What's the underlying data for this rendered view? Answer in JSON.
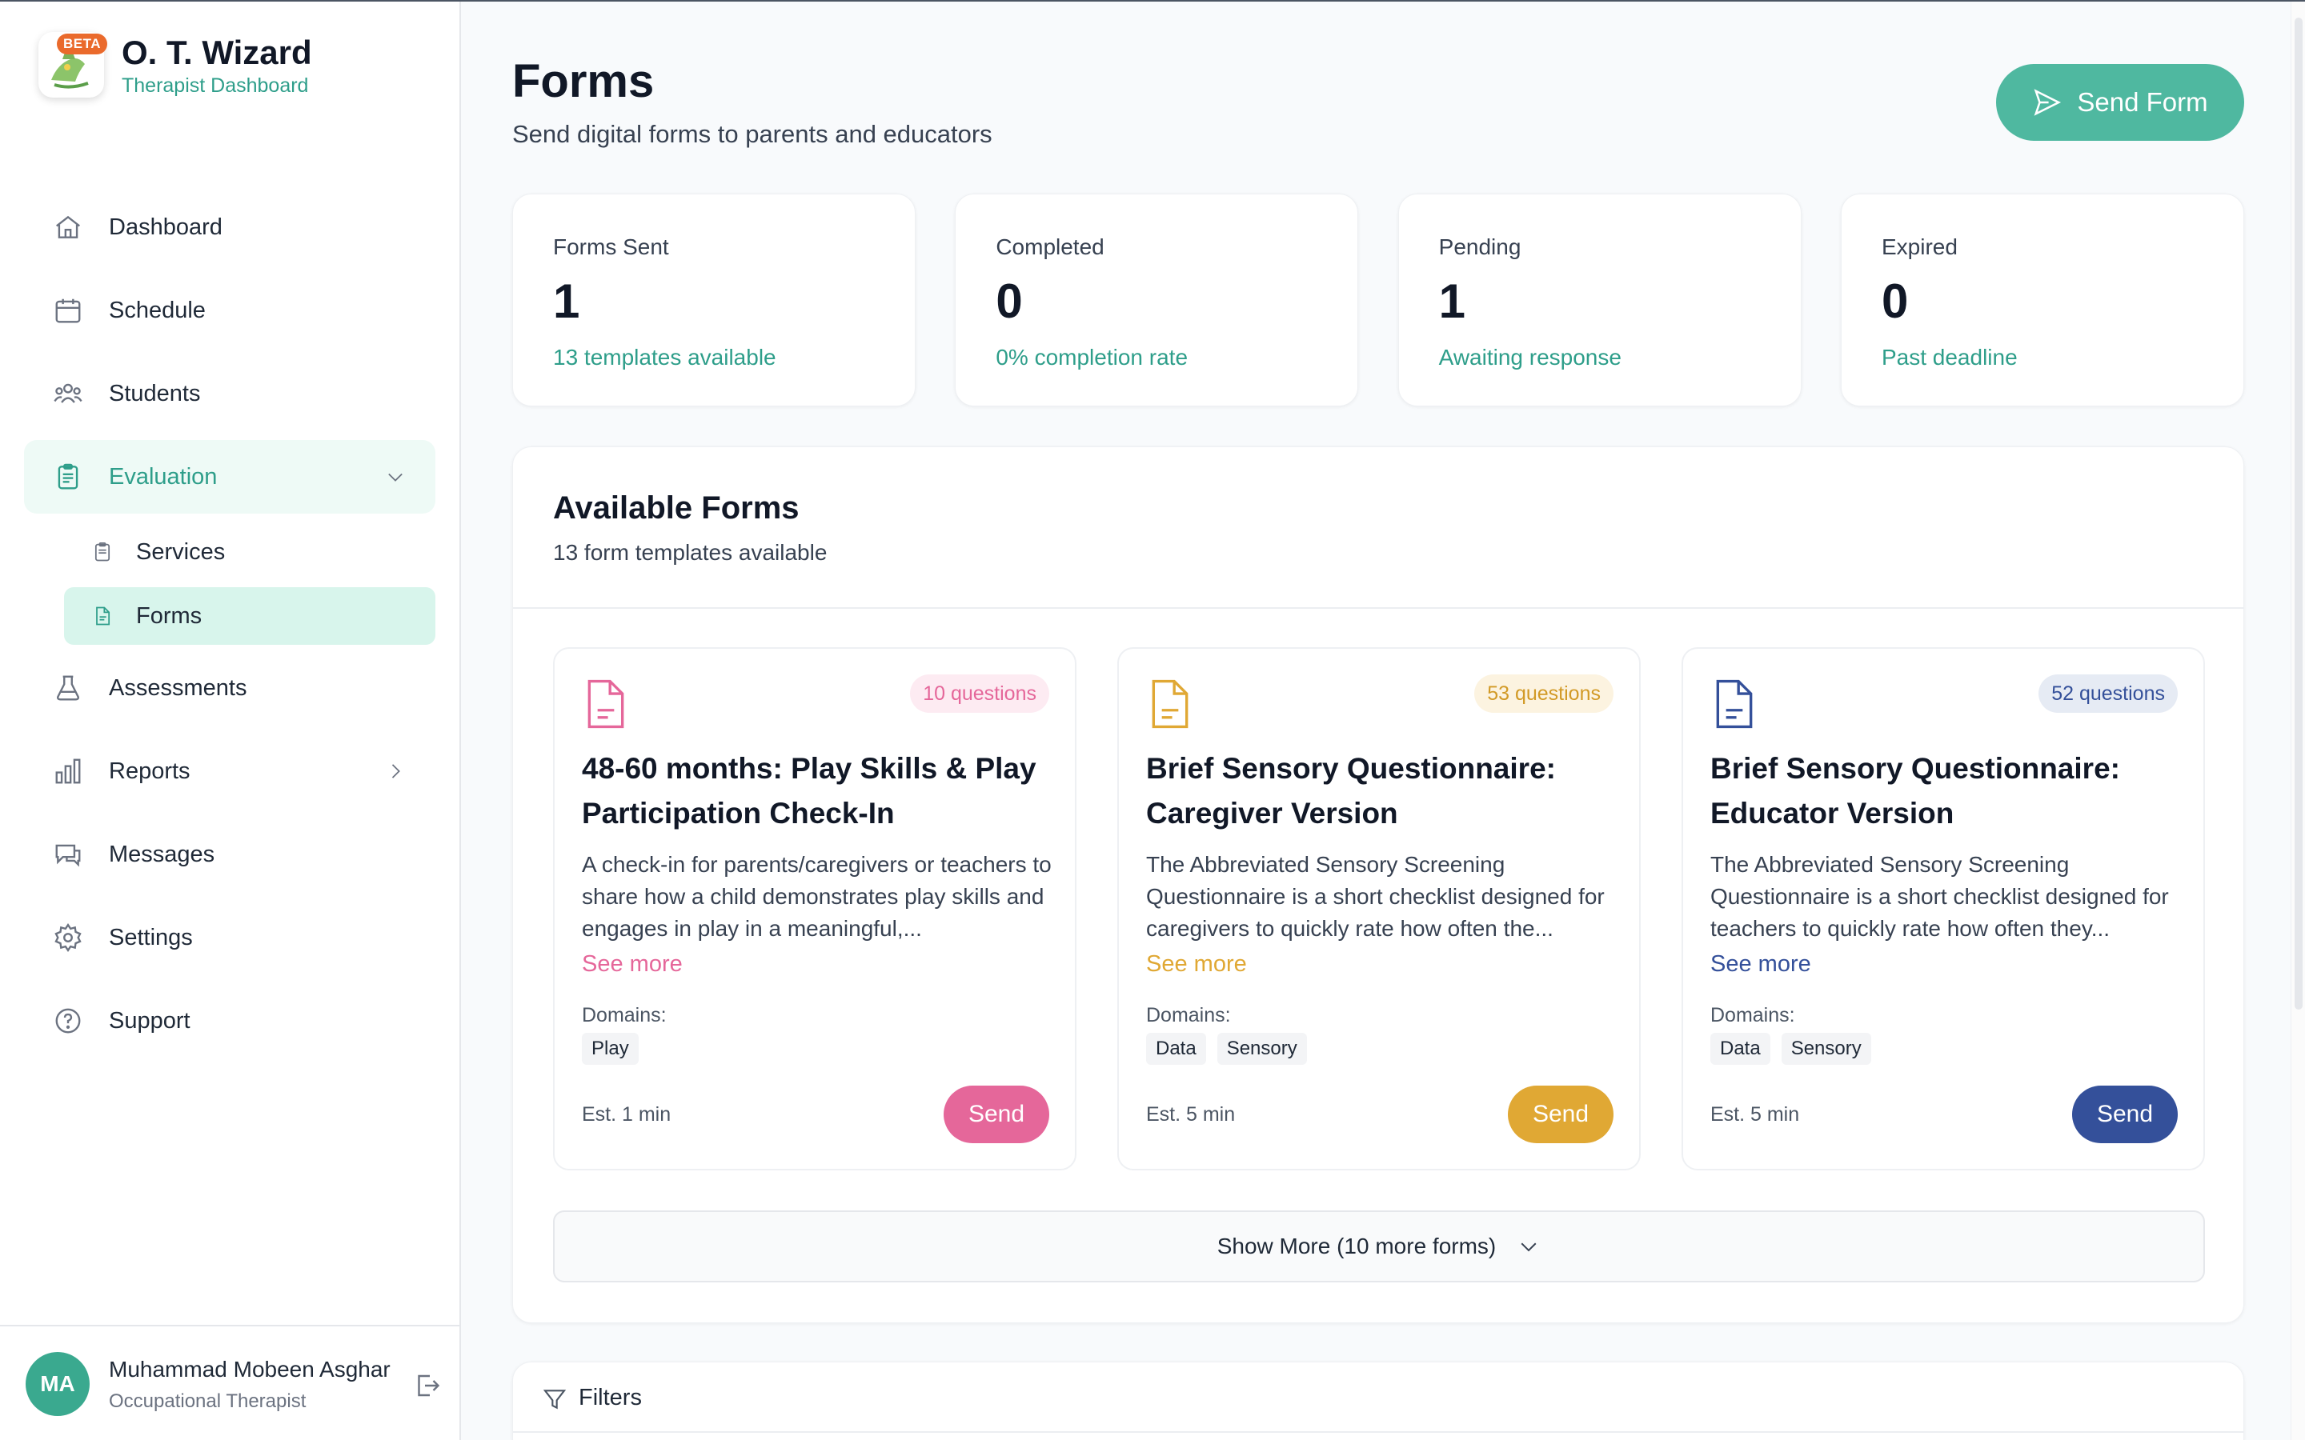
{
  "app": {
    "title": "O. T. Wizard",
    "subtitle": "Therapist Dashboard",
    "beta": "BETA"
  },
  "sidebar": {
    "items": [
      {
        "label": "Dashboard",
        "icon": "home-icon"
      },
      {
        "label": "Schedule",
        "icon": "calendar-icon"
      },
      {
        "label": "Students",
        "icon": "users-icon"
      },
      {
        "label": "Evaluation",
        "icon": "clipboard-icon",
        "expanded": true
      },
      {
        "label": "Assessments",
        "icon": "flask-icon"
      },
      {
        "label": "Reports",
        "icon": "bar-chart-icon"
      },
      {
        "label": "Messages",
        "icon": "chat-icon"
      },
      {
        "label": "Settings",
        "icon": "gear-icon"
      },
      {
        "label": "Support",
        "icon": "help-icon"
      }
    ],
    "sub_items": [
      {
        "label": "Services",
        "icon": "clipboard-icon"
      },
      {
        "label": "Forms",
        "icon": "document-icon",
        "active": true
      }
    ]
  },
  "user": {
    "initials": "MA",
    "name": "Muhammad Mobeen Asghar",
    "role": "Occupational Therapist"
  },
  "header": {
    "title": "Forms",
    "subtitle": "Send digital forms to parents and educators",
    "send_form_label": "Send Form"
  },
  "stats": [
    {
      "label": "Forms Sent",
      "value": "1",
      "note": "13 templates available"
    },
    {
      "label": "Completed",
      "value": "0",
      "note": "0% completion rate"
    },
    {
      "label": "Pending",
      "value": "1",
      "note": "Awaiting response"
    },
    {
      "label": "Expired",
      "value": "0",
      "note": "Past deadline"
    }
  ],
  "available": {
    "title": "Available Forms",
    "subtitle": "13 form templates available",
    "show_more_label": "Show More (10 more forms)",
    "domains_label": "Domains:",
    "see_more_label": "See more",
    "send_label": "Send",
    "cards": [
      {
        "title": "48-60 months: Play Skills & Play Participation Check-In",
        "questions": "10 questions",
        "description": "A check-in for parents/caregivers or teachers to share how a child demonstrates play skills and engages in play in a meaningful,...",
        "domains": [
          "Play"
        ],
        "est": "Est. 1 min",
        "accent": "#e5679a",
        "badge_bg": "#fdebf2"
      },
      {
        "title": "Brief Sensory Questionnaire: Caregiver Version",
        "questions": "53 questions",
        "description": "The Abbreviated Sensory Screening Questionnaire is a short checklist designed for caregivers to quickly rate how often the...",
        "domains": [
          "Data",
          "Sensory"
        ],
        "est": "Est. 5 min",
        "accent": "#e0a834",
        "badge_bg": "#fcf3e0"
      },
      {
        "title": "Brief Sensory Questionnaire: Educator Version",
        "questions": "52 questions",
        "description": "The Abbreviated Sensory Screening Questionnaire is a short checklist designed for teachers to quickly rate how often they...",
        "domains": [
          "Data",
          "Sensory"
        ],
        "est": "Est. 5 min",
        "accent": "#34509a",
        "badge_bg": "#e6ebf4"
      }
    ]
  },
  "filters": {
    "label": "Filters"
  },
  "colors": {
    "brand": "#2e9e8a",
    "primary_button": "#4fb8a0",
    "active_nav_bg": "#eefaf6",
    "active_sub_bg": "#d8f5ec"
  }
}
